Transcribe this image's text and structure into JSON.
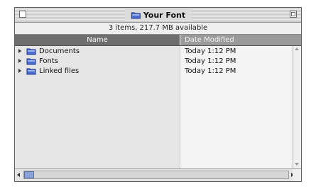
{
  "window": {
    "title": "Your Font",
    "info_text": "3 items, 217.7 MB available"
  },
  "columns": {
    "name_label": "Name",
    "date_label": "Date Modified"
  },
  "items": [
    {
      "name": "Documents",
      "date": "Today 1:12 PM",
      "icon": "folder-icon"
    },
    {
      "name": "Fonts",
      "date": "Today 1:12 PM",
      "icon": "folder-icon"
    },
    {
      "name": "Linked files",
      "date": "Today 1:12 PM",
      "icon": "folder-icon"
    }
  ],
  "colors": {
    "folder_blue": "#4a6ed0",
    "thumb_blue": "#8aa3d8",
    "header_dark": "#6e6e6e"
  }
}
